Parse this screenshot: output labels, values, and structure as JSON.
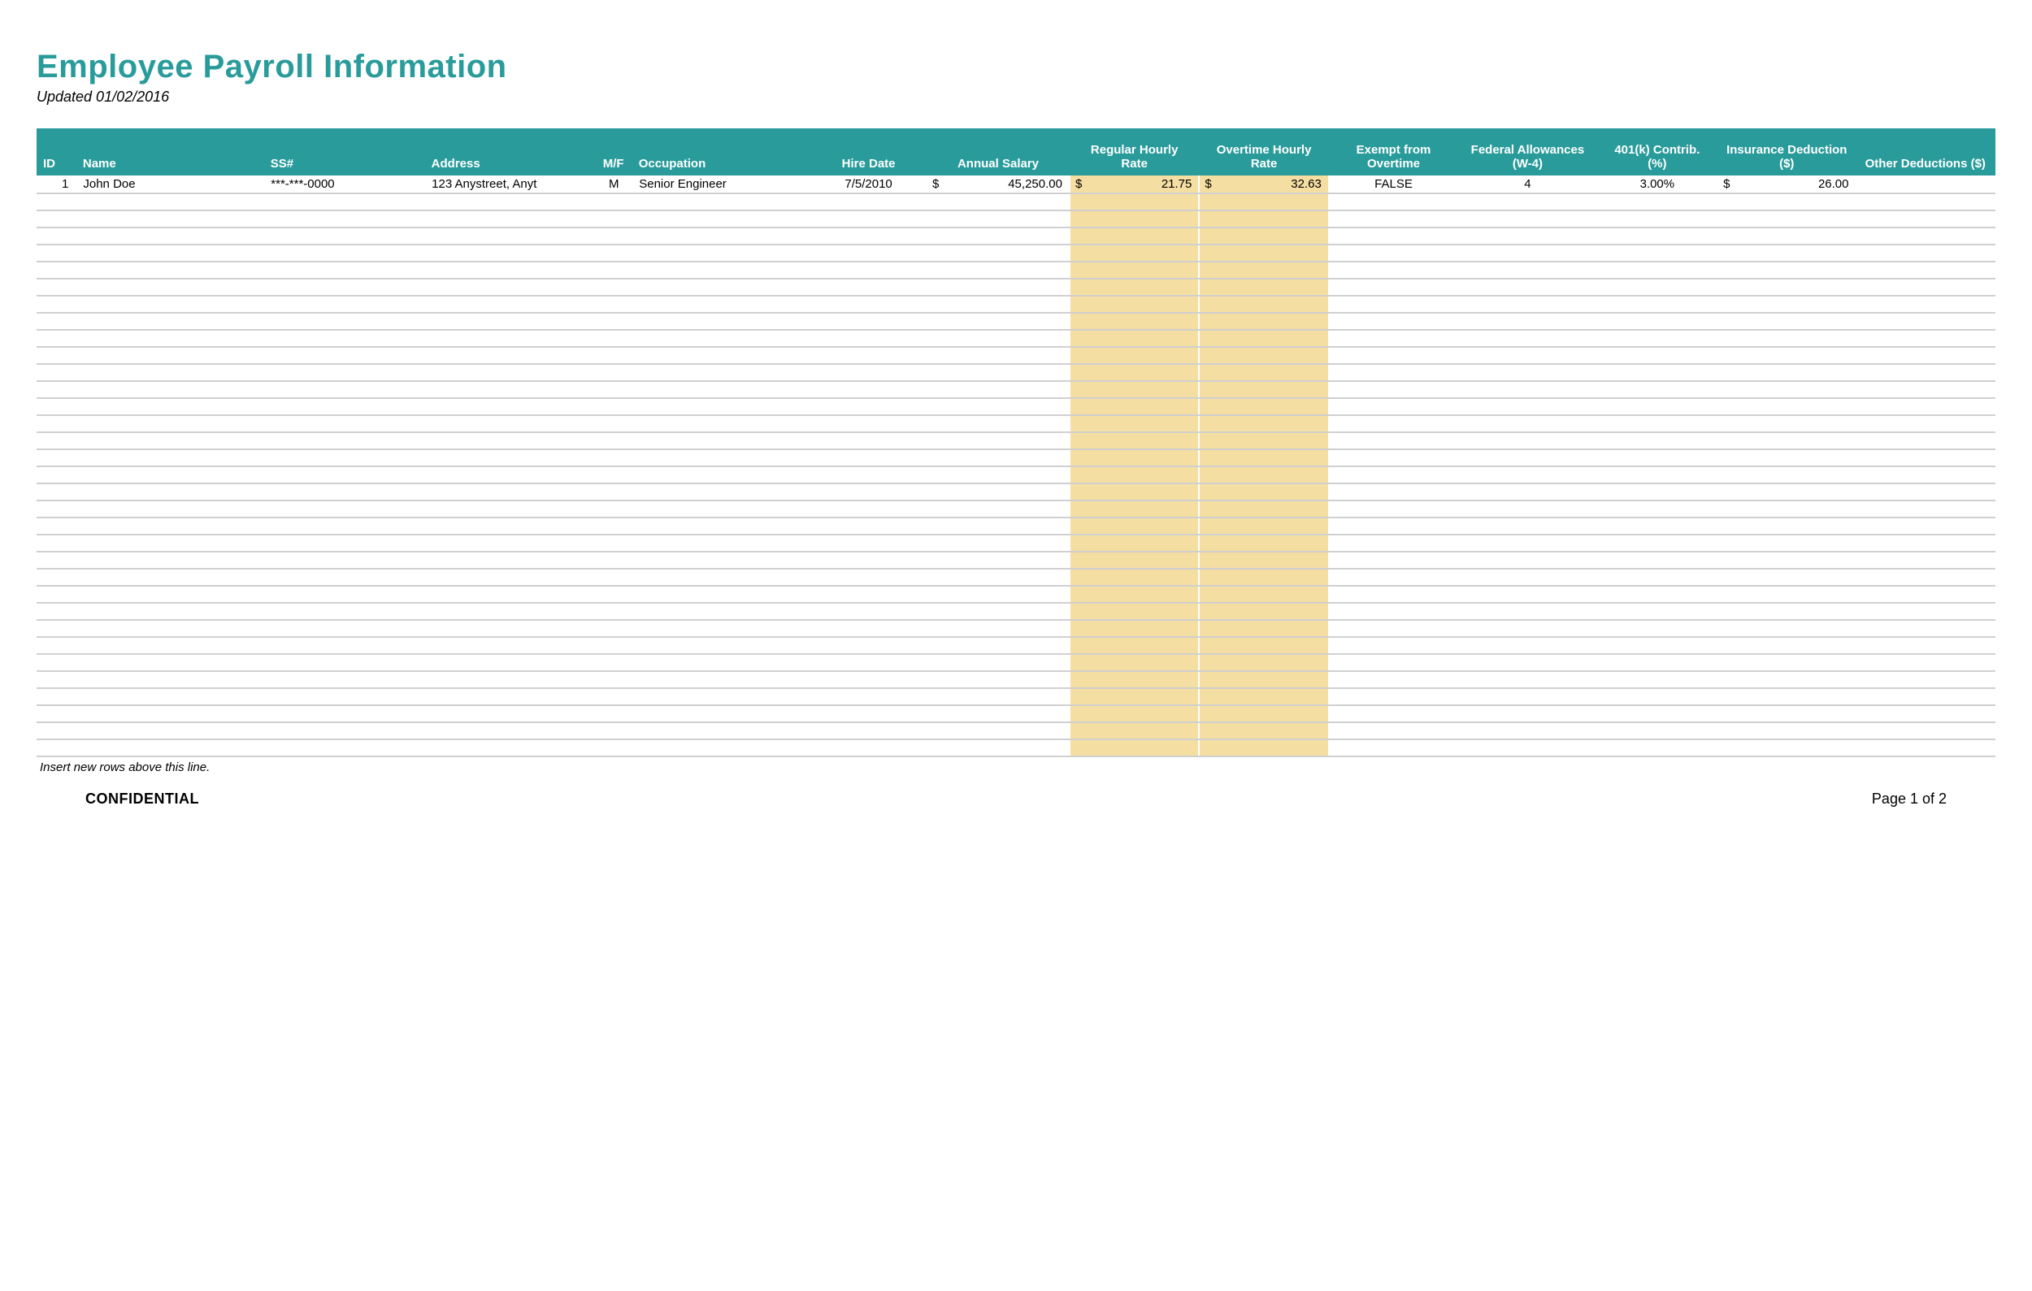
{
  "header": {
    "title": "Employee Payroll Information",
    "updated_label": "Updated 01/02/2016"
  },
  "columns": {
    "id": "ID",
    "name": "Name",
    "ss": "SS#",
    "address": "Address",
    "mf": "M/F",
    "occupation": "Occupation",
    "hire_date": "Hire Date",
    "annual_salary": "Annual Salary",
    "regular_rate": "Regular Hourly Rate",
    "overtime_rate": "Overtime Hourly Rate",
    "exempt": "Exempt from Overtime",
    "fed_allow": "Federal Allowances (W-4)",
    "k401": "401(k) Contrib. (%)",
    "insurance": "Insurance Deduction ($)",
    "other": "Other Deductions ($)"
  },
  "rows": [
    {
      "id": "1",
      "name": "John Doe",
      "ss": "***-***-0000",
      "address": "123 Anystreet, Anyt",
      "mf": "M",
      "occupation": "Senior Engineer",
      "hire_date": "7/5/2010",
      "annual_salary": "45,250.00",
      "regular_rate": "21.75",
      "overtime_rate": "32.63",
      "exempt": "FALSE",
      "fed_allow": "4",
      "k401": "3.00%",
      "insurance": "26.00",
      "other": ""
    }
  ],
  "currency": "$",
  "empty_row_count": 33,
  "notes": {
    "insert_rows": "Insert new rows above this line."
  },
  "footer": {
    "confidential": "CONFIDENTIAL",
    "page": "Page 1 of 2"
  }
}
